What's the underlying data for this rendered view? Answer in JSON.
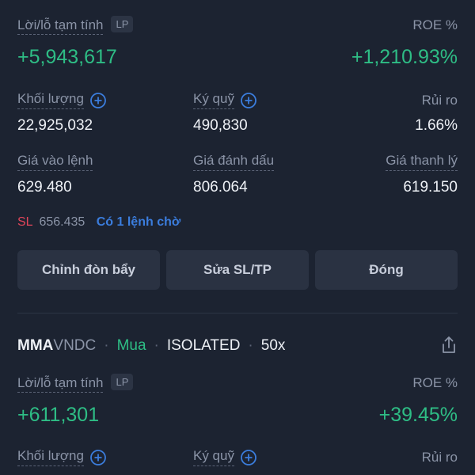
{
  "position1": {
    "pnl_label": "Lời/lỗ tạm tính",
    "lp_badge": "LP",
    "pnl_value": "+5,943,617",
    "roe_label": "ROE %",
    "roe_value": "+1,210.93%",
    "volume_label": "Khối lượng",
    "volume_value": "22,925,032",
    "margin_label": "Ký quỹ",
    "margin_value": "490,830",
    "risk_label": "Rủi ro",
    "risk_value": "1.66%",
    "entry_label": "Giá vào lệnh",
    "entry_value": "629.480",
    "mark_label": "Giá đánh dấu",
    "mark_value": "806.064",
    "liq_label": "Giá thanh lý",
    "liq_value": "619.150",
    "sl_label": "SL",
    "sl_value": "656.435",
    "pending_text": "Có 1 lệnh chờ",
    "buttons": {
      "leverage": "Chỉnh đòn bẩy",
      "edit_sltp": "Sửa SL/TP",
      "close": "Đóng"
    }
  },
  "position2": {
    "symbol_base": "MMA",
    "symbol_quote": "VNDC",
    "separator": "·",
    "side": "Mua",
    "mode": "ISOLATED",
    "leverage": "50x",
    "share_icon": "share-icon",
    "pnl_label": "Lời/lỗ tạm tính",
    "lp_badge": "LP",
    "pnl_value": "+611,301",
    "roe_label": "ROE %",
    "roe_value": "+39.45%",
    "volume_label": "Khối lượng",
    "margin_label": "Ký quỹ",
    "risk_label": "Rủi ro"
  },
  "colors": {
    "background": "#1c2331",
    "profit_green": "#2ebd85",
    "accent_blue": "#3b7ddd",
    "sl_red": "#e0455a",
    "button_bg": "#2a3242"
  }
}
